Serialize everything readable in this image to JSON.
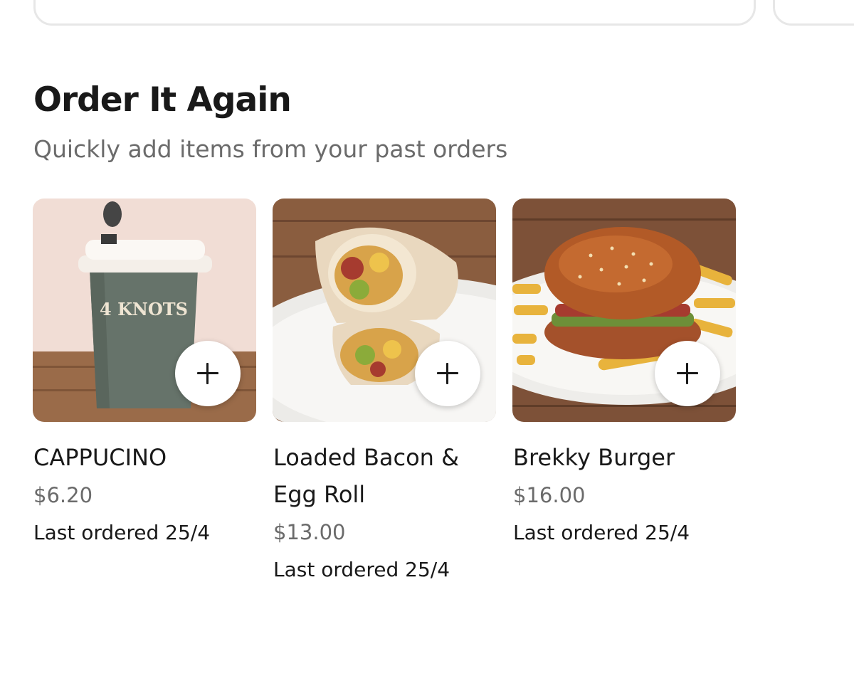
{
  "section": {
    "title": "Order It Again",
    "subtitle": "Quickly add items from your past orders"
  },
  "items": [
    {
      "name": "CAPPUCINO",
      "price": "$6.20",
      "last_ordered": "Last ordered 25/4",
      "cup_text": "4 KNOTS",
      "image_icon": "coffee-cup-photo"
    },
    {
      "name": "Loaded Bacon & Egg Roll",
      "price": "$13.00",
      "last_ordered": "Last ordered 25/4",
      "image_icon": "wrap-photo"
    },
    {
      "name": "Brekky Burger",
      "price": "$16.00",
      "last_ordered": "Last ordered 25/4",
      "image_icon": "burger-photo"
    }
  ],
  "add_button_icon": "plus-icon",
  "colors": {
    "text_primary": "#191919",
    "text_secondary": "#6b6b6b",
    "card_border": "#e7e7e7",
    "background": "#ffffff"
  }
}
